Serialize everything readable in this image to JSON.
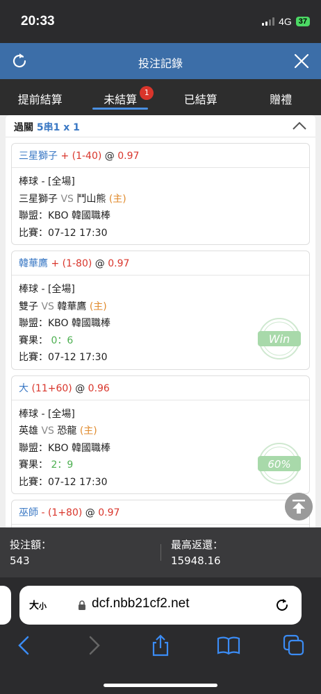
{
  "status_bar": {
    "time": "20:33",
    "network": "4G",
    "battery": "37"
  },
  "header": {
    "title": "投注記錄"
  },
  "tabs": [
    {
      "label": "提前結算"
    },
    {
      "label": "未結算",
      "badge": "1"
    },
    {
      "label": "已結算"
    },
    {
      "label": "贈禮"
    }
  ],
  "summary": {
    "label": "過關",
    "count": "5串1 x 1"
  },
  "bets": [
    {
      "team": "三星獅子",
      "handicap": "+ (1-40)",
      "at": "@",
      "odds": "0.97",
      "sport": "棒球 - [全場]",
      "team_a": "三星獅子",
      "vs": "VS",
      "team_b": "鬥山熊",
      "home": "(主)",
      "league": "聯盟：KBO 韓國職棒",
      "time": "比賽：07-12 17:30"
    },
    {
      "team": "韓華鷹",
      "handicap": "+ (1-80)",
      "at": "@",
      "odds": "0.97",
      "sport": "棒球 - [全場]",
      "team_a": "雙子",
      "vs": "VS",
      "team_b": "韓華鷹",
      "home": "(主)",
      "league": "聯盟：KBO 韓國職棒",
      "result_label": "賽果：",
      "result": "0：6",
      "time": "比賽：07-12 17:30",
      "stamp": "Win"
    },
    {
      "team": "大",
      "handicap": "(11+60)",
      "at": "@",
      "odds": "0.96",
      "sport": "棒球 - [全場]",
      "team_a": "英雄",
      "vs": "VS",
      "team_b": "恐龍",
      "home": "(主)",
      "league": "聯盟：KBO 韓國職棒",
      "result_label": "賽果：",
      "result": "2：9",
      "time": "比賽：07-12 17:30",
      "stamp": "60%"
    },
    {
      "team": "巫師",
      "handicap": "- (1+80)",
      "at": "@",
      "odds": "0.97"
    }
  ],
  "footer": {
    "stake_label": "投注額：",
    "stake": "543",
    "max_return_label": "最高返還：",
    "max_return": "15948.16"
  },
  "browser": {
    "text_size": "大",
    "text_size_small": "小",
    "url": "dcf.nbb21cf2.net"
  },
  "colors": {
    "header": "#3c6ea8",
    "accent": "#3a78c4",
    "red": "#d9352b",
    "green": "#4caf50",
    "orange": "#e08a2c"
  }
}
